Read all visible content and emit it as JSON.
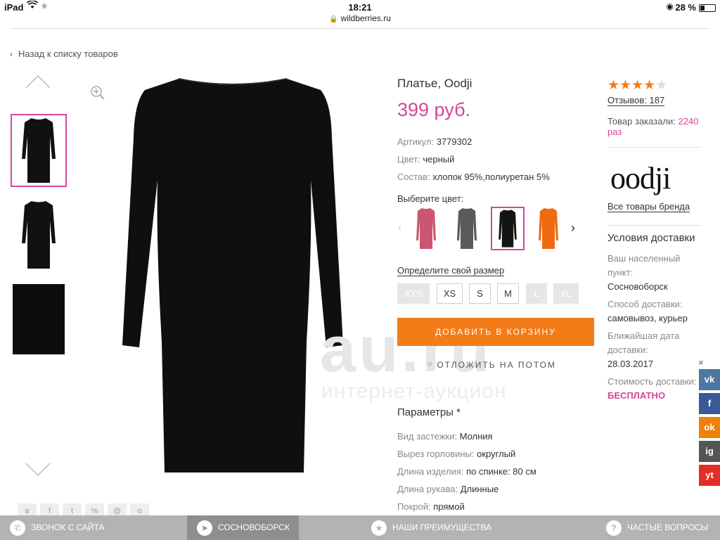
{
  "status": {
    "device": "iPad",
    "time": "18:21",
    "battery": "28 %",
    "url": "wildberries.ru"
  },
  "nav": {
    "back": "Назад к списку товаров"
  },
  "gallery": {
    "watermark": "au.ru",
    "watermark_sub": "интернет-аукцион"
  },
  "product": {
    "title": "Платье, Oodji",
    "price": "399 руб.",
    "props": [
      {
        "label": "Артикул:",
        "value": "3779302"
      },
      {
        "label": "Цвет:",
        "value": "черный"
      },
      {
        "label": "Состав:",
        "value": "хлопок 95%,полиуретан 5%"
      }
    ],
    "choose_color": "Выберите цвет:",
    "swatch_colors": [
      "#cc5670",
      "#5a5a5a",
      "#141414",
      "#f06a12"
    ],
    "size_link": "Определите свой размер",
    "sizes": [
      {
        "label": "XXS",
        "available": false
      },
      {
        "label": "XS",
        "available": true
      },
      {
        "label": "S",
        "available": true
      },
      {
        "label": "M",
        "available": true
      },
      {
        "label": "L",
        "available": false
      },
      {
        "label": "XL",
        "available": false
      }
    ],
    "add_to_cart": "ДОБАВИТЬ В КОРЗИНУ",
    "save_later": "ОТЛОЖИТЬ НА ПОТОМ",
    "params_title": "Параметры *",
    "params": [
      {
        "label": "Вид застежки:",
        "value": "Молния"
      },
      {
        "label": "Вырез горловины:",
        "value": "округлый"
      },
      {
        "label": "Длина изделия:",
        "value": "по спинке: 80 см"
      },
      {
        "label": "Длина рукава:",
        "value": "Длинные"
      },
      {
        "label": "Покрой:",
        "value": "прямой"
      }
    ]
  },
  "side": {
    "rating": 4,
    "rating_max": 5,
    "reviews": "Отзывов: 187",
    "ordered_label": "Товар заказали:",
    "ordered_count": "2240",
    "ordered_unit": "раз",
    "brand_logo": "oodji",
    "brand_link": "Все товары бренда",
    "delivery_title": "Условия доставки",
    "delivery": [
      {
        "label": "Ваш населенный пункт:",
        "value": "Сосновоборск"
      },
      {
        "label": "Способ доставки:",
        "value": "самовывоз, курьер"
      },
      {
        "label": "Ближайшая дата доставки:",
        "value": "28.03.2017"
      },
      {
        "label": "Стоимость доставки:",
        "value": "БЕСПЛАТНО"
      }
    ]
  },
  "social": [
    "vk",
    "f",
    "ok",
    "ig",
    "yt"
  ],
  "bottom": [
    {
      "label": "ЗВОНОК С САЙТА",
      "icon": "phone-icon"
    },
    {
      "label": "СОСНОВОБОРСК",
      "icon": "location-arrow-icon"
    },
    {
      "label": "НАШИ ПРЕИМУЩЕСТВА",
      "icon": "star-icon"
    },
    {
      "label": "ЧАСТЫЕ ВОПРОСЫ",
      "icon": "question-icon"
    }
  ]
}
